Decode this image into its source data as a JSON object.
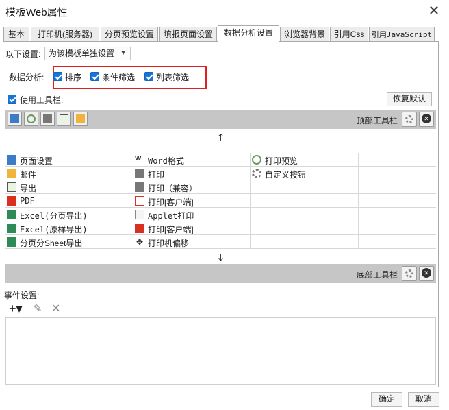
{
  "window": {
    "title": "模板Web属性",
    "close_icon": "close-icon"
  },
  "tabs": [
    {
      "label": "基本"
    },
    {
      "label": "打印机(服务器)"
    },
    {
      "label": "分页预览设置"
    },
    {
      "label": "填报页面设置"
    },
    {
      "label": "数据分析设置",
      "active": true
    },
    {
      "label": "浏览器背景"
    },
    {
      "label": "引用Css"
    },
    {
      "label": "引用JavaScript"
    }
  ],
  "settings": {
    "label": "以下设置:",
    "select_value": "为该模板单独设置"
  },
  "analysis": {
    "label": "数据分析:",
    "options": [
      {
        "label": "排序",
        "checked": true
      },
      {
        "label": "条件筛选",
        "checked": true
      },
      {
        "label": "列表筛选",
        "checked": true
      }
    ]
  },
  "toolbar_option": {
    "label": "使用工具栏:",
    "checked": true,
    "restore_button": "恢复默认"
  },
  "top_toolbar": {
    "label": "顶部工具栏",
    "icons": [
      "page-setup-icon",
      "print-preview-icon",
      "print-icon",
      "export-icon",
      "email-icon"
    ]
  },
  "bottom_toolbar": {
    "label": "底部工具栏"
  },
  "grid_rows": [
    [
      {
        "icon": "page-setup-icon",
        "text": "页面设置"
      },
      {
        "icon": "word-icon",
        "text": "Word格式"
      },
      {
        "icon": "print-preview-icon",
        "text": "打印预览"
      },
      {
        "icon": "",
        "text": ""
      }
    ],
    [
      {
        "icon": "email-icon",
        "text": "邮件"
      },
      {
        "icon": "print-icon",
        "text": "打印"
      },
      {
        "icon": "gear-icon",
        "text": "自定义按钮"
      },
      {
        "icon": "",
        "text": ""
      }
    ],
    [
      {
        "icon": "export-icon",
        "text": "导出"
      },
      {
        "icon": "print-icon",
        "text": "打印（兼容）"
      },
      {
        "icon": "",
        "text": ""
      },
      {
        "icon": "",
        "text": ""
      }
    ],
    [
      {
        "icon": "pdf-icon",
        "text": "PDF"
      },
      {
        "icon": "pdf-print-icon",
        "text": "打印[客户端]"
      },
      {
        "icon": "",
        "text": ""
      },
      {
        "icon": "",
        "text": ""
      }
    ],
    [
      {
        "icon": "excel-icon",
        "text": "Excel(分页导出)"
      },
      {
        "icon": "applet-icon",
        "text": "Applet打印"
      },
      {
        "icon": "",
        "text": ""
      },
      {
        "icon": "",
        "text": ""
      }
    ],
    [
      {
        "icon": "excel-icon",
        "text": "Excel(原样导出)"
      },
      {
        "icon": "pdf-icon",
        "text": "打印[客户端]"
      },
      {
        "icon": "",
        "text": ""
      },
      {
        "icon": "",
        "text": ""
      }
    ],
    [
      {
        "icon": "excel-icon",
        "text": "分页分Sheet导出"
      },
      {
        "icon": "move-icon",
        "text": "打印机偏移"
      },
      {
        "icon": "",
        "text": ""
      },
      {
        "icon": "",
        "text": ""
      }
    ]
  ],
  "events": {
    "label": "事件设置:",
    "add_icon": "plus-icon",
    "edit_icon": "pencil-icon",
    "delete_icon": "delete-icon"
  },
  "footer": {
    "ok": "确定",
    "cancel": "取消"
  }
}
